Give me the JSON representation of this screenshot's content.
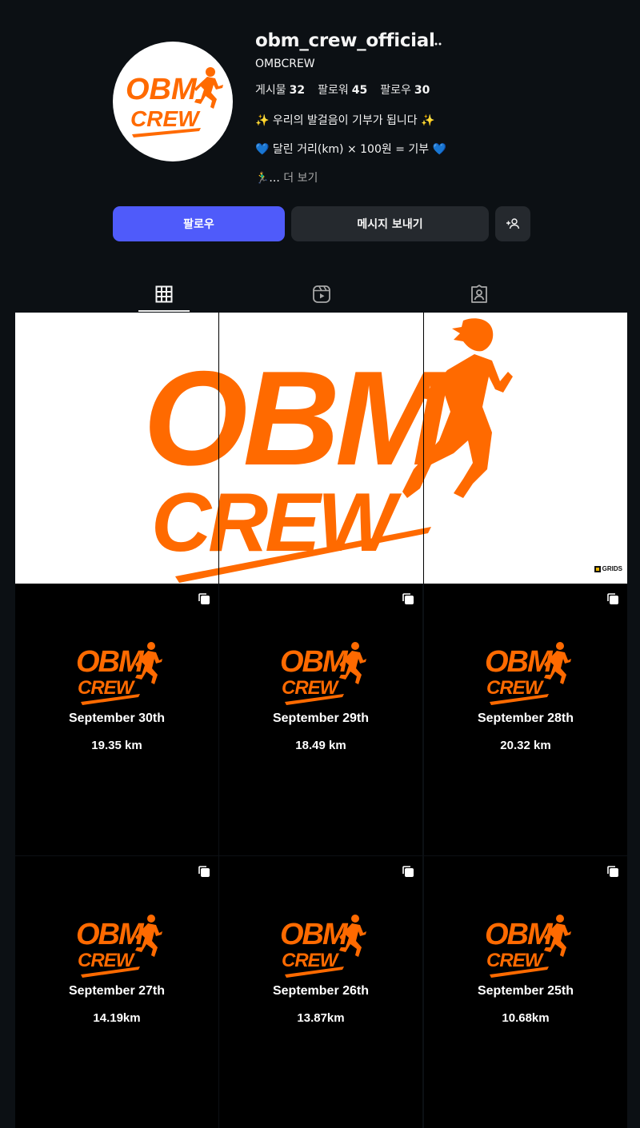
{
  "profile": {
    "username": "obm_crew_official",
    "more_icon": "ellipsis-icon",
    "full_name": "OMBCREW",
    "stats": [
      {
        "label": "게시물",
        "value": "32"
      },
      {
        "label": "팔로워",
        "value": "45"
      },
      {
        "label": "팔로우",
        "value": "30"
      }
    ],
    "bio": {
      "line1": "✨ 우리의 발걸음이 기부가 됩니다 ✨",
      "line2": "💙 달린 거리(km) × 100원 = 기부 💙",
      "line3_prefix": "🏃‍♂️...",
      "more": "더 보기"
    },
    "avatar_text": [
      "OBM",
      "CREW"
    ]
  },
  "actions": {
    "follow": "팔로우",
    "message": "메시지 보내기",
    "suggest_icon": "add-person-icon"
  },
  "tabs": [
    {
      "icon": "grid-icon",
      "active": true
    },
    {
      "icon": "reels-icon",
      "active": false
    },
    {
      "icon": "tagged-icon",
      "active": false
    }
  ],
  "banner": {
    "logo_text": [
      "OBM",
      "CREW"
    ],
    "badge": "GRIDS"
  },
  "posts": [
    {
      "date": "September 30th",
      "distance": "19.35 km"
    },
    {
      "date": "September 29th",
      "distance": "18.49 km"
    },
    {
      "date": "September 28th",
      "distance": "20.32 km"
    },
    {
      "date": "September 27th",
      "distance": "14.19km"
    },
    {
      "date": "September 26th",
      "distance": "13.87km"
    },
    {
      "date": "September 25th",
      "distance": "10.68km"
    }
  ],
  "post_logo_text": [
    "OBM",
    "CREW"
  ],
  "colors": {
    "background": "#0c1014",
    "brand_orange": "#ff6a00",
    "follow_button": "#4f5bfa",
    "secondary_button": "#25292e"
  }
}
